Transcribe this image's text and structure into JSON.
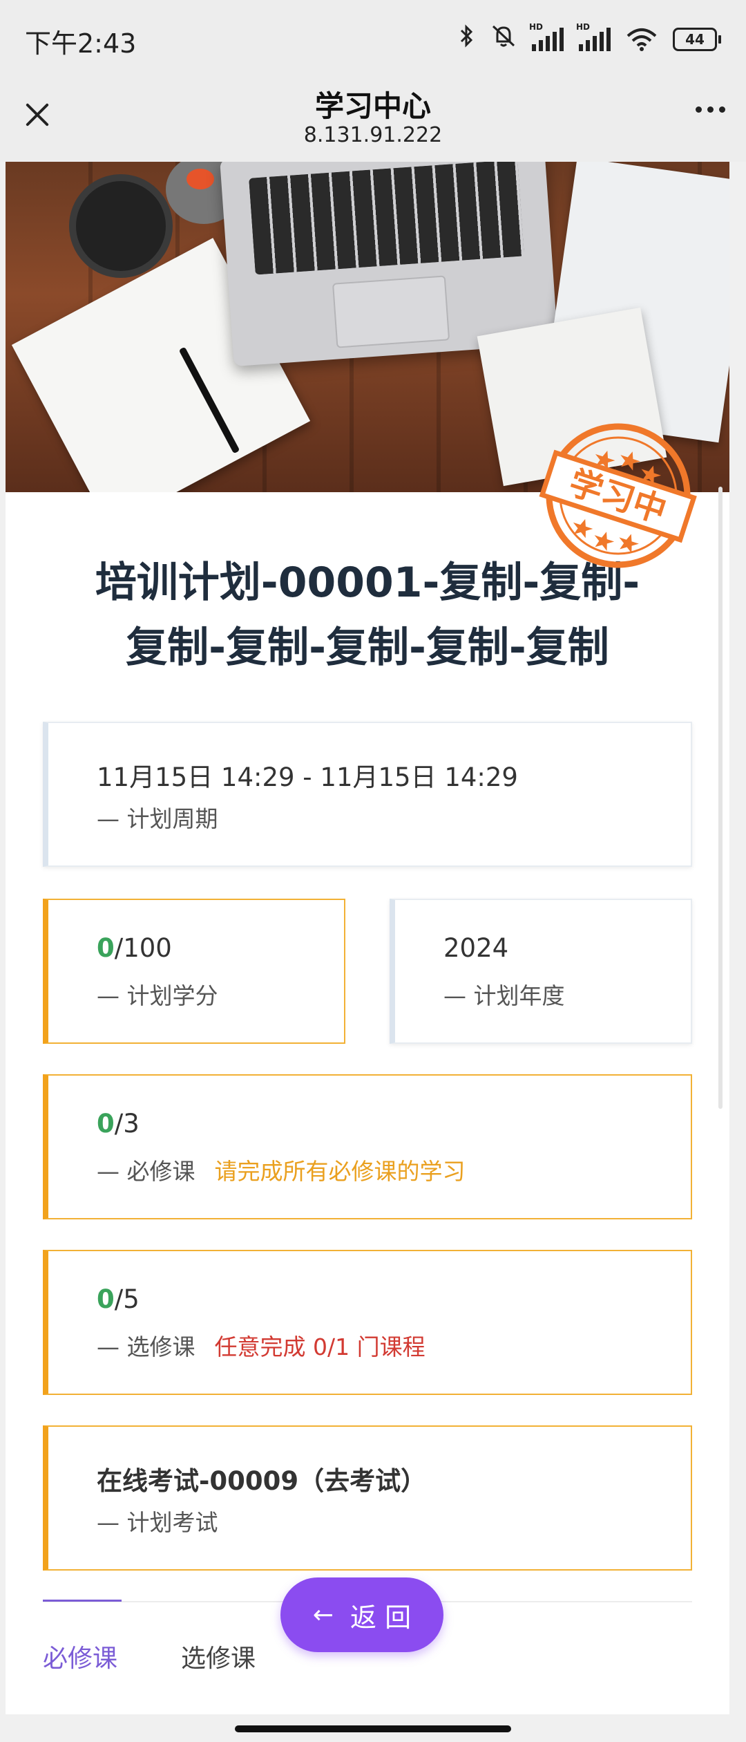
{
  "status_bar": {
    "time": "下午2:43",
    "signal_label": "HD",
    "battery": "44"
  },
  "title_bar": {
    "title": "学习中心",
    "subtitle": "8.131.91.222"
  },
  "banner": {
    "stamp_text": "学习中",
    "stamp_color": "#f0782a"
  },
  "plan": {
    "title_line1": "培训计划-00001-复制-复制-",
    "title_line2": "复制-复制-复制-复制-复制"
  },
  "period": {
    "value": "11月15日 14:29 - 11月15日 14:29",
    "label": "— 计划周期"
  },
  "credits": {
    "earned": "0",
    "total": "/100",
    "label": "— 计划学分"
  },
  "year": {
    "value": "2024",
    "label": "— 计划年度"
  },
  "required": {
    "done": "0",
    "total": "/3",
    "label": "— 必修课",
    "hint": "请完成所有必修课的学习"
  },
  "elective": {
    "done": "0",
    "total": "/5",
    "label": "—  选修课",
    "hint": "任意完成 0/1 门课程"
  },
  "exam": {
    "link": "在线考试-00009（去考试）",
    "label": "—  计划考试"
  },
  "tabs": [
    {
      "label": "必修课",
      "active": true
    },
    {
      "label": "选修课",
      "active": false
    }
  ],
  "back_button": {
    "label": "返 回",
    "color": "#8b4cf0"
  },
  "colors": {
    "accent_orange": "#f2a21c",
    "success_green": "#3aa35b",
    "danger_red": "#d23a32",
    "tab_active": "#7b5cd6"
  }
}
